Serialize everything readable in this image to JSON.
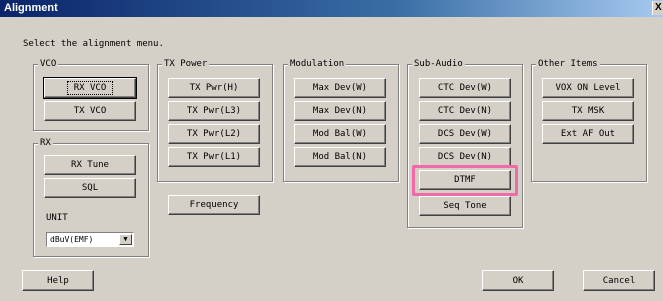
{
  "window": {
    "title": "Alignment",
    "close_glyph": "X"
  },
  "prompt": "Select the alignment menu.",
  "groups": {
    "vco": {
      "legend": "VCO",
      "buttons": [
        "RX VCO",
        "TX VCO"
      ]
    },
    "rx": {
      "legend": "RX",
      "buttons": [
        "RX Tune",
        "SQL"
      ],
      "unit_label": "UNIT",
      "unit_value": "dBuV(EMF)",
      "unit_arrow": "▼"
    },
    "tx_power": {
      "legend": "TX Power",
      "buttons": [
        "TX Pwr(H)",
        "TX Pwr(L3)",
        "TX Pwr(L2)",
        "TX Pwr(L1)"
      ]
    },
    "modulation": {
      "legend": "Modulation",
      "buttons": [
        "Max Dev(W)",
        "Max Dev(N)",
        "Mod Bal(W)",
        "Mod Bal(N)"
      ]
    },
    "sub_audio": {
      "legend": "Sub-Audio",
      "buttons": [
        "CTC Dev(W)",
        "CTC Dev(N)",
        "DCS Dev(W)",
        "DCS Dev(N)",
        "DTMF",
        "Seq Tone"
      ]
    },
    "other": {
      "legend": "Other Items",
      "buttons": [
        "VOX ON Level",
        "TX MSK",
        "Ext AF Out"
      ]
    }
  },
  "frequency_button": "Frequency",
  "footer": {
    "help": "Help",
    "ok": "OK",
    "cancel": "Cancel"
  },
  "highlight_color": "#f06aa8"
}
